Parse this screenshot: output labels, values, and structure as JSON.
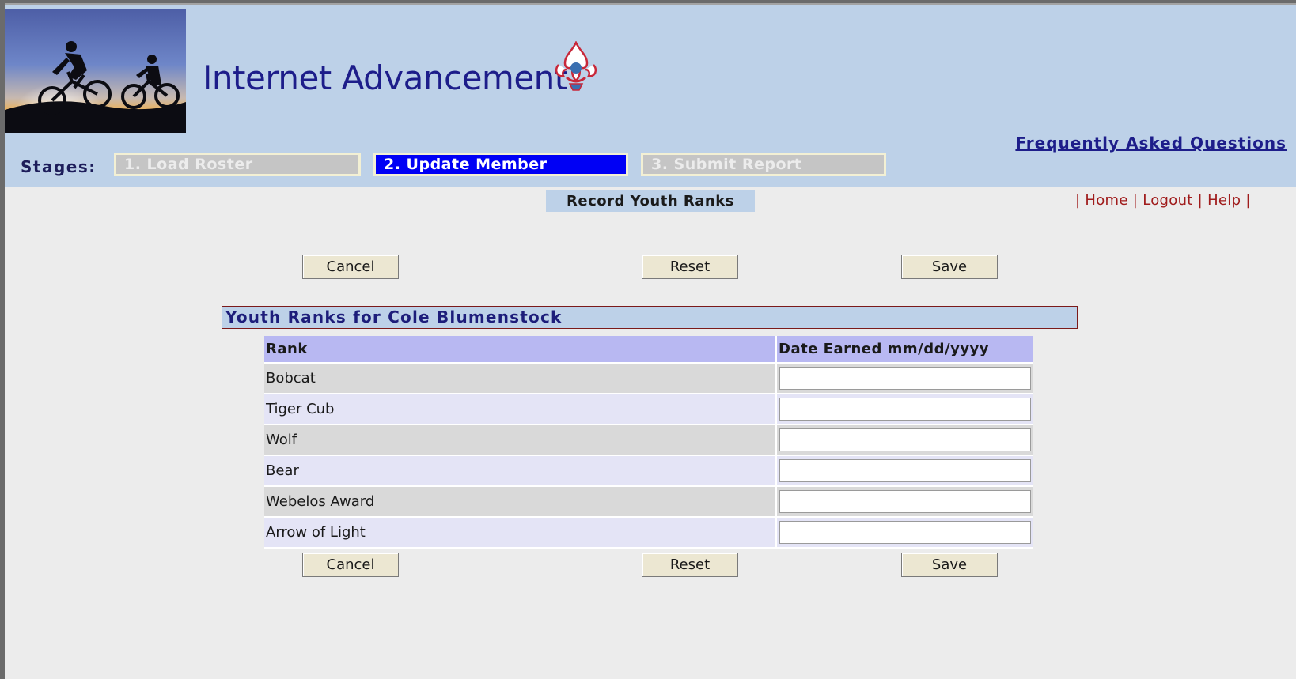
{
  "app": {
    "title": "Internet Advancement"
  },
  "header": {
    "faq_link": "Frequently Asked Questions"
  },
  "stages": {
    "label": "Stages:",
    "items": [
      {
        "label": "1. Load Roster",
        "active": false
      },
      {
        "label": "2. Update Member",
        "active": true
      },
      {
        "label": "3. Submit Report",
        "active": false
      }
    ]
  },
  "page": {
    "section_title": "Record Youth Ranks"
  },
  "nav_links": {
    "sep": "|",
    "home": "Home",
    "logout": "Logout",
    "help": "Help"
  },
  "buttons": {
    "cancel": "Cancel",
    "reset": "Reset",
    "save": "Save"
  },
  "ranks": {
    "header": "Youth Ranks for Cole Blumenstock",
    "columns": {
      "rank": "Rank",
      "date": "Date Earned mm/dd/yyyy"
    },
    "rows": [
      {
        "rank": "Bobcat",
        "date": ""
      },
      {
        "rank": "Tiger Cub",
        "date": ""
      },
      {
        "rank": "Wolf",
        "date": ""
      },
      {
        "rank": "Bear",
        "date": ""
      },
      {
        "rank": "Webelos Award",
        "date": ""
      },
      {
        "rank": "Arrow of Light",
        "date": ""
      }
    ]
  },
  "colors": {
    "header_bg": "#bdd1e8",
    "active_stage": "#0000f5",
    "inactive_stage": "#c5c5c5",
    "link_red": "#a01c1c",
    "title_navy": "#1d1d8a",
    "table_header": "#b8b8f2"
  },
  "icons": {
    "banner": "bicycle-riders-sunset-image",
    "emblem": "scout-fleur-de-lis-emblem"
  }
}
